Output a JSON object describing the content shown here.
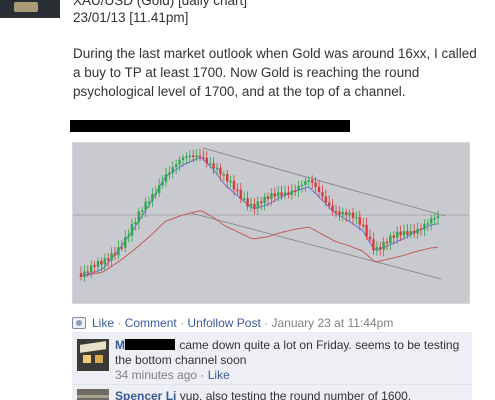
{
  "post": {
    "title": "XAU/USD (Gold) [daily chart]",
    "date": "23/01/13 [11.41pm]",
    "body": "During the last market outlook when Gold was around 16xx, I called a buy to TP at least 1700. Now Gold is reaching the round psychological level of 1700, and at the top of a channel."
  },
  "actions": {
    "like": "Like",
    "comment": "Comment",
    "unfollow": "Unfollow Post",
    "timestamp": "January 23 at 11:44pm",
    "separator": "·"
  },
  "comments": [
    {
      "author": "M",
      "text": "came down quite a lot on Friday. seems to be testing the bottom channel soon",
      "time": "34 minutes ago",
      "like": "Like"
    },
    {
      "author": "Spencer Li",
      "text": "yup, also testing the round number of 1600."
    }
  ],
  "colors": {
    "link": "#3b5998",
    "bull_candle": "#2ea84a",
    "bear_candle": "#d83b3b",
    "chart_bg": "#c9cacf",
    "ma_fast": "#6b6fd8",
    "ma_slow": "#c55a5a"
  },
  "icons": [
    "facebook-post-icon",
    "avatar-house-image"
  ]
}
